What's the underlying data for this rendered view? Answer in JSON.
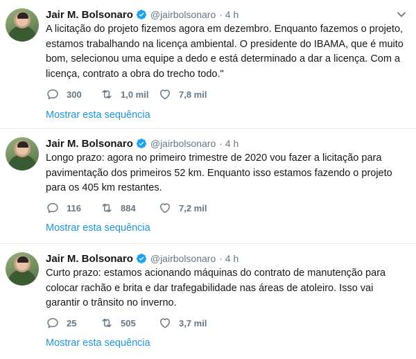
{
  "tweets": [
    {
      "name": "Jair M. Bolsonaro",
      "handle": "@jairbolsonaro",
      "time": "· 4 h",
      "text": "A licitação do projeto fizemos agora em dezembro. Enquanto fazemos o projeto, estamos trabalhando na licença ambiental. O presidente do IBAMA, que é muito bom, selecionou uma equipe a dedo e está determinado a dar a licença. Com a licença, contrato a obra do trecho todo.\"",
      "replies": "300",
      "retweets": "1,0 mil",
      "likes": "7,8 mil",
      "thread_link": "Mostrar esta sequência"
    },
    {
      "name": "Jair M. Bolsonaro",
      "handle": "@jairbolsonaro",
      "time": "· 4 h",
      "text": "Longo prazo: agora no primeiro trimestre de 2020 vou fazer a licitação para pavimentação dos primeiros 52 km. Enquanto isso estamos fazendo o projeto para os 405 km restantes.",
      "replies": "116",
      "retweets": "884",
      "likes": "7,2 mil",
      "thread_link": "Mostrar esta sequência"
    },
    {
      "name": "Jair M. Bolsonaro",
      "handle": "@jairbolsonaro",
      "time": "· 4 h",
      "text": "Curto prazo: estamos acionando máquinas do contrato de manutenção para colocar rachão e brita e dar trafegabilidade nas áreas de atoleiro. Isso vai garantir o trânsito no inverno.",
      "replies": "25",
      "retweets": "505",
      "likes": "3,7 mil",
      "thread_link": "Mostrar esta sequência"
    }
  ],
  "colors": {
    "text": "#14171a",
    "secondary": "#657786",
    "link": "#1b95e0",
    "verified": "#1da1f2",
    "divider": "#e6ecf0"
  },
  "icons": {
    "verified": "verified-badge-icon",
    "chevron": "chevron-down-icon",
    "reply": "reply-icon",
    "retweet": "retweet-icon",
    "like": "heart-icon"
  }
}
